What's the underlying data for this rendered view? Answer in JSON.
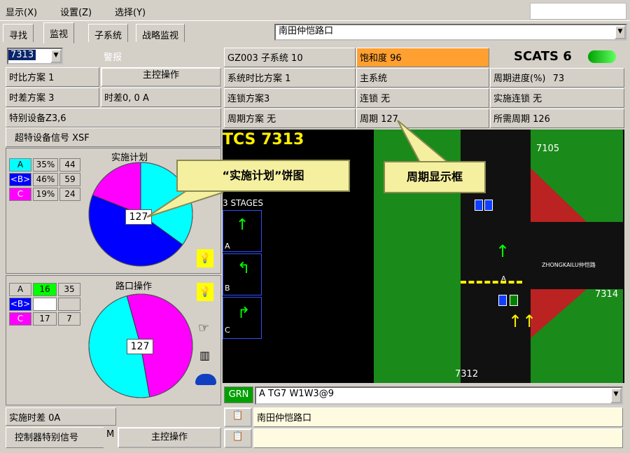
{
  "menu": {
    "display": "显示(X)",
    "settings": "设置(Z)",
    "select": "选择(Y)"
  },
  "tabs": [
    "寻找",
    "监视",
    "子系统",
    "战略监视"
  ],
  "intersection_select": "南田仲恺路口",
  "left": {
    "tcs_select": "7313",
    "alarm": "警报",
    "split_plan": "时比方案 1",
    "master_control_btn": "主控操作",
    "offset_plan": "时差方案 3",
    "offset": "时差0, 0 A",
    "special_equipment": "特别设备Z3,6",
    "super_equipment_signal": "超特设备信号 XSF",
    "plan_pie_title": "实施计划",
    "plan_rows": [
      {
        "phase": "A",
        "pct": "35%",
        "sec": "44",
        "color": "#00ffff"
      },
      {
        "phase": "<B>",
        "pct": "46%",
        "sec": "59",
        "color": "#0000ff"
      },
      {
        "phase": "C",
        "pct": "19%",
        "sec": "24",
        "color": "#ff00ff"
      }
    ],
    "plan_cycle": "127",
    "intersection_pie_title": "路口操作",
    "inter_rows": [
      {
        "phase": "A",
        "a": "16",
        "b": "35"
      },
      {
        "phase": "<B>",
        "a": "",
        "b": ""
      },
      {
        "phase": "C",
        "a": "17",
        "b": "7"
      }
    ],
    "inter_cycle": "127",
    "applied_offset": "实施时差 0A",
    "controller_special_signal": "控制器特别信号",
    "controller_m": "M",
    "master_control_btn2": "主控操作"
  },
  "status": {
    "subsystem": "GZ003 子系统 10",
    "saturation": "饱和度 96",
    "brand": "SCATS 6",
    "system_split": "系统时比方案 1",
    "master_system": "主系统",
    "cycle_progress_label": "周期进度(%)",
    "cycle_progress_value": "73",
    "link_plan": "连锁方案3",
    "link": "连锁 无",
    "applied_link": "实施连锁 无",
    "cycle_plan": "周期方案 无",
    "cycle": "周期 127",
    "required_cycle": "所需周期 126"
  },
  "map": {
    "title": "TCS 7313",
    "stages": "3 STAGES",
    "stage_labels": [
      "A",
      "B",
      "C"
    ],
    "n7105": "7105",
    "n7314": "7314",
    "n7312": "7312",
    "road_label": "ZHONGKAILU仲恺路",
    "phase_a_label": "A"
  },
  "callouts": {
    "pie": "“实施计划”饼图",
    "cycle_box": "周期显示框"
  },
  "bottom": {
    "grn": "GRN",
    "phase_select": "A TG7 W1W3@9",
    "name": "南田仲恺路口",
    "empty": ""
  },
  "chart_data": [
    {
      "type": "pie",
      "title": "实施计划",
      "categories": [
        "A",
        "<B>",
        "C"
      ],
      "values": [
        35,
        46,
        19
      ],
      "colors": [
        "#00ffff",
        "#0000ff",
        "#ff00ff"
      ],
      "center_label": "127"
    },
    {
      "type": "pie",
      "title": "路口操作",
      "categories": [
        "A",
        "<B>",
        "C"
      ],
      "values": [
        16,
        0,
        17
      ],
      "colors": [
        "#00ffff",
        "#ffffff",
        "#ff00ff"
      ],
      "center_label": "127"
    }
  ]
}
